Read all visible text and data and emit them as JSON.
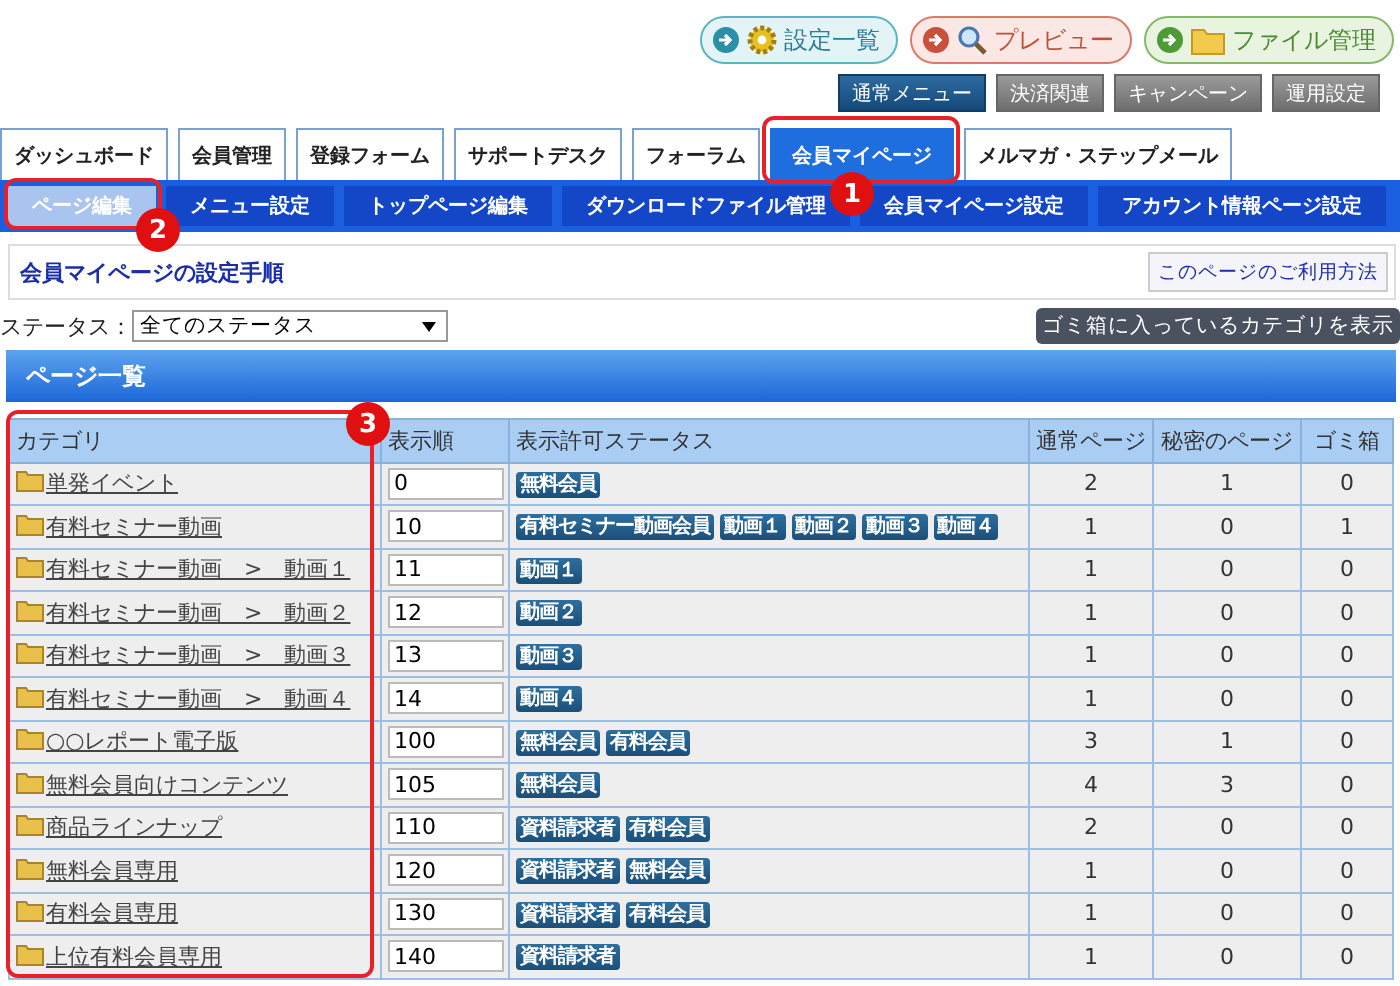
{
  "header_buttons": [
    {
      "label": "設定一覧",
      "kind": "settings"
    },
    {
      "label": "プレビュー",
      "kind": "preview"
    },
    {
      "label": "ファイル管理",
      "kind": "files"
    }
  ],
  "menu_switch": [
    {
      "label": "通常メニュー",
      "selected": true
    },
    {
      "label": "決済関連",
      "selected": false
    },
    {
      "label": "キャンペーン",
      "selected": false
    },
    {
      "label": "運用設定",
      "selected": false
    }
  ],
  "tabs": [
    {
      "label": "ダッシュボード",
      "selected": false
    },
    {
      "label": "会員管理",
      "selected": false
    },
    {
      "label": "登録フォーム",
      "selected": false
    },
    {
      "label": "サポートデスク",
      "selected": false
    },
    {
      "label": "フォーラム",
      "selected": false
    },
    {
      "label": "会員マイページ",
      "selected": true
    },
    {
      "label": "メルマガ・ステップメール",
      "selected": false
    }
  ],
  "subnav": [
    {
      "label": "ページ編集",
      "selected": true
    },
    {
      "label": "メニュー設定",
      "selected": false
    },
    {
      "label": "トップページ編集",
      "selected": false
    },
    {
      "label": "ダウンロードファイル管理",
      "selected": false
    },
    {
      "label": "会員マイページ設定",
      "selected": false
    },
    {
      "label": "アカウント情報ページ設定",
      "selected": false
    }
  ],
  "guide": {
    "link": "会員マイページの設定手順",
    "help_button": "このページのご利用方法"
  },
  "status_filter": {
    "label": "ステータス：",
    "value": "全てのステータス"
  },
  "trash_button": "ゴミ箱に入っているカテゴリを表示",
  "section_title": "ページ一覧",
  "table": {
    "columns": [
      "カテゴリ",
      "表示順",
      "表示許可ステータス",
      "通常ページ",
      "秘密のページ",
      "ゴミ箱"
    ],
    "rows": [
      {
        "category": "単発イベント",
        "order": "0",
        "statuses": [
          "無料会員"
        ],
        "normal": "2",
        "secret": "1",
        "trash": "0"
      },
      {
        "category": "有料セミナー動画",
        "order": "10",
        "statuses": [
          "有料セミナー動画会員",
          "動画１",
          "動画２",
          "動画３",
          "動画４"
        ],
        "normal": "1",
        "secret": "0",
        "trash": "1"
      },
      {
        "category": "有料セミナー動画　>　動画１",
        "order": "11",
        "statuses": [
          "動画１"
        ],
        "normal": "1",
        "secret": "0",
        "trash": "0"
      },
      {
        "category": "有料セミナー動画　>　動画２",
        "order": "12",
        "statuses": [
          "動画２"
        ],
        "normal": "1",
        "secret": "0",
        "trash": "0"
      },
      {
        "category": "有料セミナー動画　>　動画３",
        "order": "13",
        "statuses": [
          "動画３"
        ],
        "normal": "1",
        "secret": "0",
        "trash": "0"
      },
      {
        "category": "有料セミナー動画　>　動画４",
        "order": "14",
        "statuses": [
          "動画４"
        ],
        "normal": "1",
        "secret": "0",
        "trash": "0"
      },
      {
        "category": "○○レポート電子版",
        "order": "100",
        "statuses": [
          "無料会員",
          "有料会員"
        ],
        "normal": "3",
        "secret": "1",
        "trash": "0"
      },
      {
        "category": "無料会員向けコンテンツ",
        "order": "105",
        "statuses": [
          "無料会員"
        ],
        "normal": "4",
        "secret": "3",
        "trash": "0"
      },
      {
        "category": "商品ラインナップ",
        "order": "110",
        "statuses": [
          "資料請求者",
          "有料会員"
        ],
        "normal": "2",
        "secret": "0",
        "trash": "0"
      },
      {
        "category": "無料会員専用",
        "order": "120",
        "statuses": [
          "資料請求者",
          "無料会員"
        ],
        "normal": "1",
        "secret": "0",
        "trash": "0"
      },
      {
        "category": "有料会員専用",
        "order": "130",
        "statuses": [
          "資料請求者",
          "有料会員"
        ],
        "normal": "1",
        "secret": "0",
        "trash": "0"
      },
      {
        "category": "上位有料会員専用",
        "order": "140",
        "statuses": [
          "資料請求者"
        ],
        "normal": "1",
        "secret": "0",
        "trash": "0"
      }
    ]
  },
  "annotations": [
    {
      "number": "1"
    },
    {
      "number": "2"
    },
    {
      "number": "3"
    }
  ]
}
